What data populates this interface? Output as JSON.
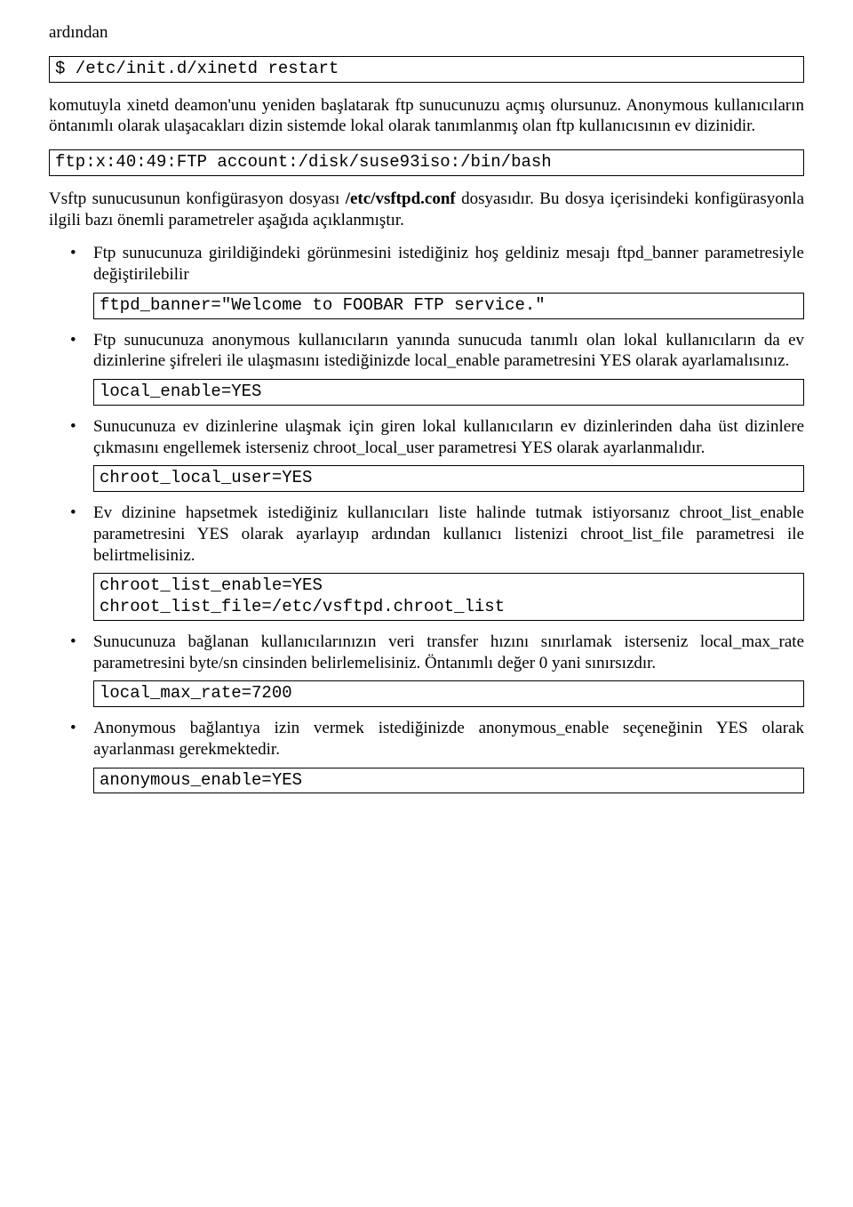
{
  "intro": {
    "p0": "ardından",
    "code0": "$ /etc/init.d/xinetd restart",
    "p1": "komutuyla xinetd deamon'unu yeniden başlatarak ftp sunucunuzu açmış olursunuz. Anonymous kullanıcıların öntanımlı olarak ulaşacakları dizin sistemde lokal olarak tanımlanmış olan ftp kullanıcısının ev dizinidir.",
    "code1": "ftp:x:40:49:FTP account:/disk/suse93iso:/bin/bash",
    "p2_before": "Vsftp sunucusunun konfigürasyon dosyası ",
    "p2_bold": "/etc/vsftpd.conf",
    "p2_after": " dosyasıdır. Bu dosya içerisindeki konfigürasyonla ilgili bazı önemli parametreler aşağıda açıklanmıştır."
  },
  "items": [
    {
      "text": "Ftp sunucunuza girildiğindeki görünmesini istediğiniz hoş geldiniz mesajı ftpd_banner parametresiyle değiştirilebilir",
      "code": "ftpd_banner=\"Welcome to FOOBAR FTP service.\""
    },
    {
      "text": "Ftp sunucunuza anonymous kullanıcıların yanında sunucuda tanımlı olan lokal kullanıcıların da ev dizinlerine şifreleri ile ulaşmasını istediğinizde local_enable parametresini YES olarak ayarlamalısınız.",
      "code": "local_enable=YES"
    },
    {
      "text": "Sunucunuza ev dizinlerine ulaşmak için giren lokal kullanıcıların ev dizinlerinden daha üst dizinlere çıkmasını engellemek isterseniz chroot_local_user parametresi YES olarak ayarlanmalıdır.",
      "code": "chroot_local_user=YES"
    },
    {
      "text": "Ev dizinine hapsetmek istediğiniz kullanıcıları liste halinde  tutmak istiyorsanız chroot_list_enable parametresini YES olarak ayarlayıp ardından kullanıcı listenizi chroot_list_file parametresi ile belirtmelisiniz.",
      "code": "chroot_list_enable=YES\nchroot_list_file=/etc/vsftpd.chroot_list"
    },
    {
      "text": "Sunucunuza bağlanan kullanıcılarınızın veri transfer hızını sınırlamak isterseniz local_max_rate parametresini byte/sn cinsinden belirlemelisiniz. Öntanımlı değer 0 yani sınırsızdır.",
      "code": "local_max_rate=7200"
    },
    {
      "text": "Anonymous bağlantıya izin vermek istediğinizde anonymous_enable seçeneğinin YES olarak ayarlanması gerekmektedir.",
      "code": "anonymous_enable=YES"
    }
  ]
}
